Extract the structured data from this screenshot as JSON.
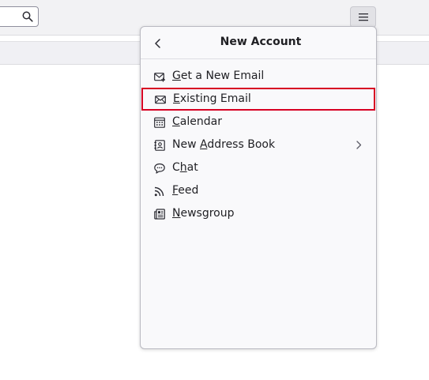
{
  "toolbar": {
    "search": {
      "placeholder": ""
    },
    "menu_icon": "hamburger-icon"
  },
  "panel": {
    "title": "New Account",
    "back_icon": "chevron-left-icon",
    "items": [
      {
        "pre": "",
        "key": "G",
        "post": "et a New Email",
        "icon": "new-email-icon",
        "submenu": false
      },
      {
        "pre": "",
        "key": "E",
        "post": "xisting Email",
        "icon": "envelope-icon",
        "submenu": false,
        "focused": true
      },
      {
        "pre": "",
        "key": "C",
        "post": "alendar",
        "icon": "calendar-icon",
        "submenu": false
      },
      {
        "pre": "New ",
        "key": "A",
        "post": "ddress Book",
        "icon": "address-book-icon",
        "submenu": true
      },
      {
        "pre": "C",
        "key": "h",
        "post": "at",
        "icon": "chat-icon",
        "submenu": false
      },
      {
        "pre": "",
        "key": "F",
        "post": "eed",
        "icon": "feed-icon",
        "submenu": false
      },
      {
        "pre": "",
        "key": "N",
        "post": "ewsgroup",
        "icon": "newsgroup-icon",
        "submenu": false
      }
    ]
  },
  "colors": {
    "focus_ring": "#d70022",
    "panel_bg": "#f9f9fb",
    "toolbar_bg": "#f2f2f4"
  }
}
